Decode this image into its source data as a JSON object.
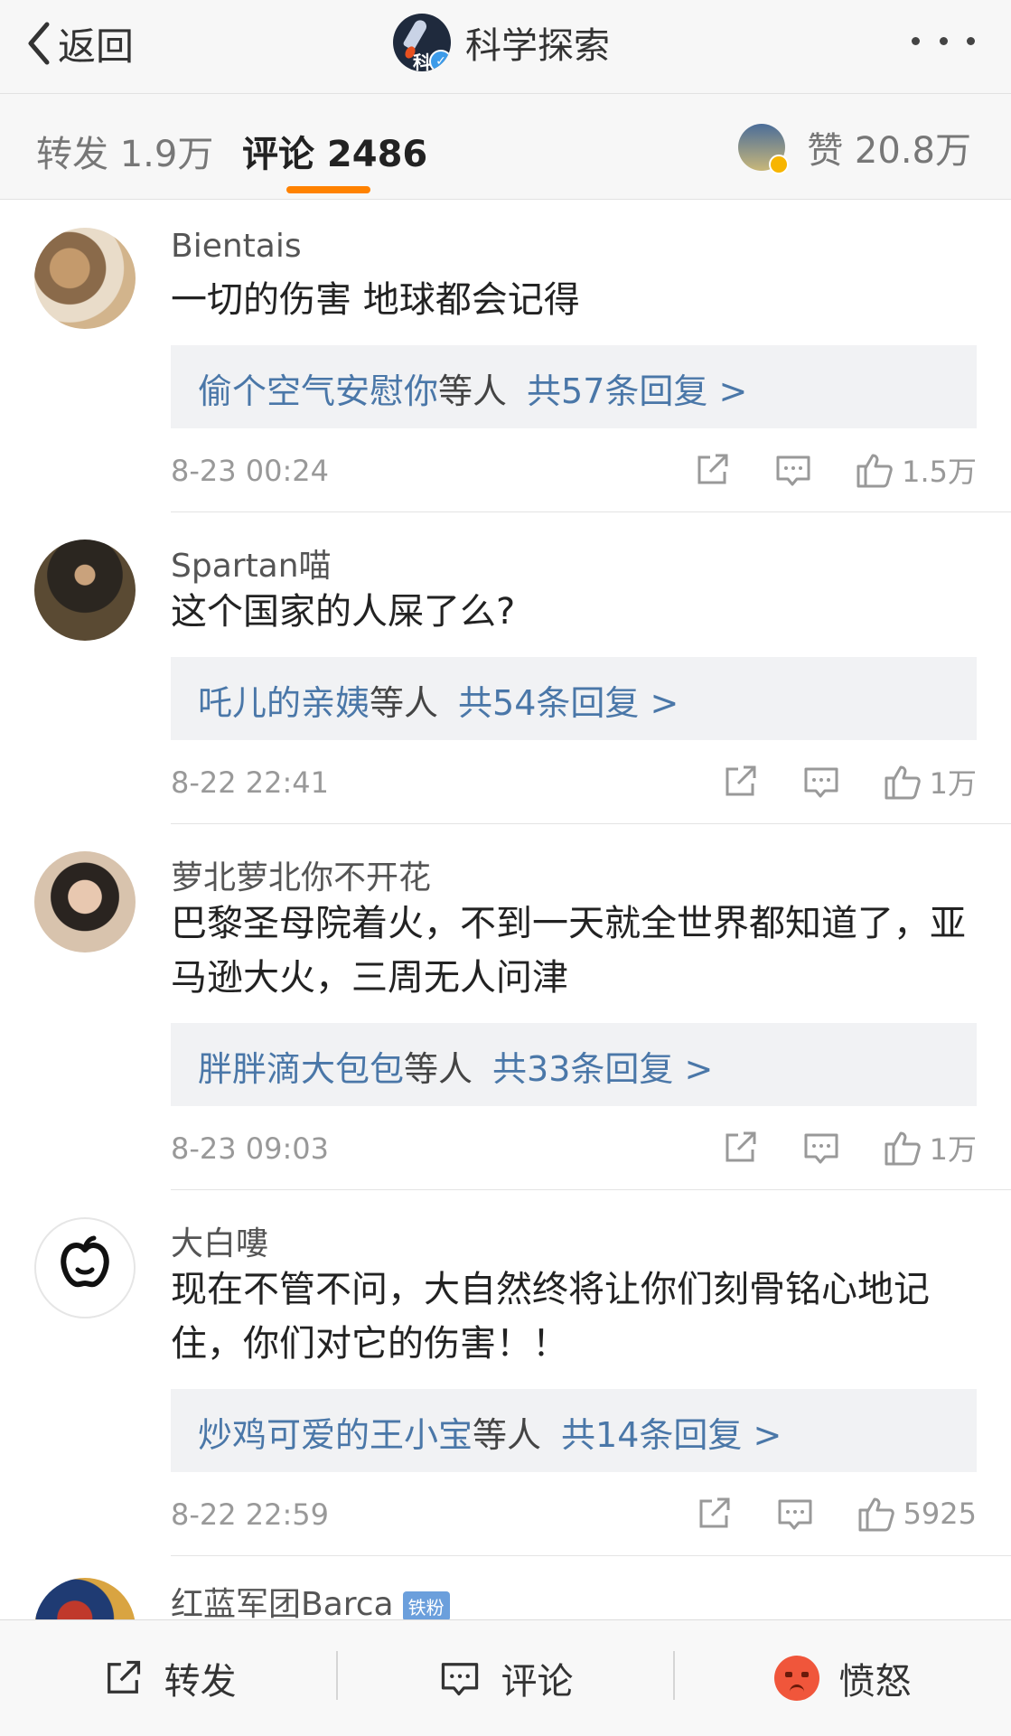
{
  "header": {
    "back_label": "返回",
    "account_name": "科学探索",
    "logo_text": "科"
  },
  "tabs": {
    "repost": "转发 1.9万",
    "comments": "评论 2486",
    "likes": "赞 20.8万"
  },
  "comments": [
    {
      "user": "Bientais",
      "text": "一切的伤害 地球都会记得",
      "reply_users": "偷个空气安慰你",
      "reply_suffix": "等人",
      "reply_count": "共57条回复 >",
      "time": "8-23 00:24",
      "likes": "1.5万"
    },
    {
      "user": "Spartan喵",
      "text": "这个国家的人屎了么?",
      "reply_users": "吒儿的亲姨",
      "reply_suffix": "等人",
      "reply_count": "共54条回复 >",
      "time": "8-22 22:41",
      "likes": "1万"
    },
    {
      "user": "萝北萝北你不开花",
      "text": "巴黎圣母院着火，不到一天就全世界都知道了，亚马逊大火，三周无人问津",
      "reply_users": "胖胖滴大包包",
      "reply_suffix": "等人",
      "reply_count": "共33条回复 >",
      "time": "8-23 09:03",
      "likes": "1万"
    },
    {
      "user": "大白嘍",
      "text": "现在不管不问，大自然终将让你们刻骨铭心地记住，你们对它的伤害！！",
      "reply_users": "炒鸡可爱的王小宝",
      "reply_suffix": "等人",
      "reply_count": "共14条回复 >",
      "time": "8-22 22:59",
      "likes": "5925"
    },
    {
      "user": "红蓝军团Barca",
      "badge": "铁粉"
    }
  ],
  "bottom_bar": {
    "repost": "转发",
    "comment": "评论",
    "reaction": "愤怒"
  },
  "colors": {
    "accent_orange": "#ff8200",
    "link_blue": "#4a77a8",
    "reply_bg": "#f1f2f4",
    "verified_blue": "#3d9be9"
  }
}
